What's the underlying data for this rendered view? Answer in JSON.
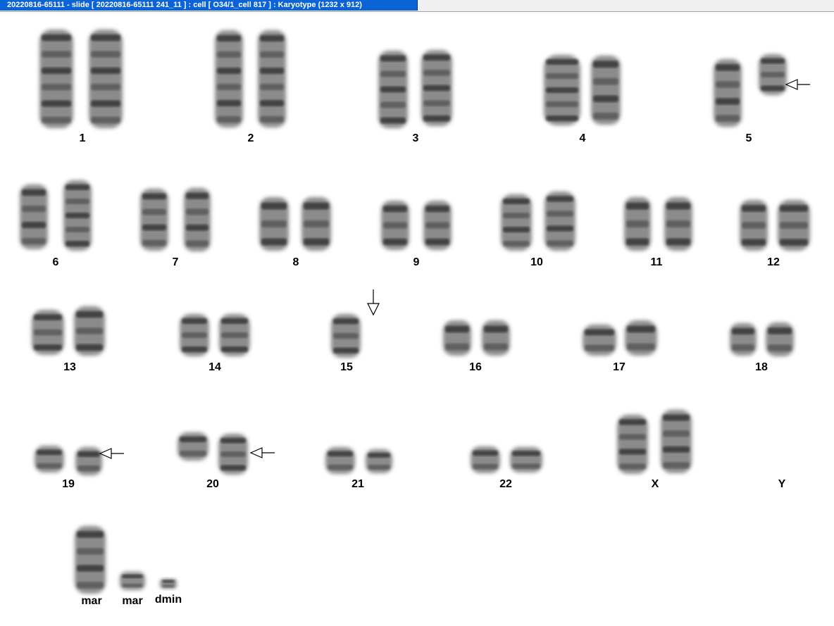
{
  "window": {
    "title": "20220816-65111 - slide [ 20220816-65111 241_11 ] : cell [ O34/1_cell 817 ] : Karyotype  (1232 x 912)"
  },
  "karyotype": {
    "labels": [
      "1",
      "2",
      "3",
      "4",
      "5",
      "6",
      "7",
      "8",
      "9",
      "10",
      "11",
      "12",
      "13",
      "14",
      "15",
      "16",
      "17",
      "18",
      "19",
      "20",
      "21",
      "22",
      "X",
      "Y",
      "mar",
      "mar",
      "dmin"
    ],
    "abnormality_arrows": [
      "5",
      "15",
      "19",
      "20"
    ]
  },
  "colors": {
    "title_bar": "#0a64d8",
    "chromosome_dark": "#2a2a2a",
    "chromosome_mid": "#777777",
    "background": "#ffffff"
  }
}
